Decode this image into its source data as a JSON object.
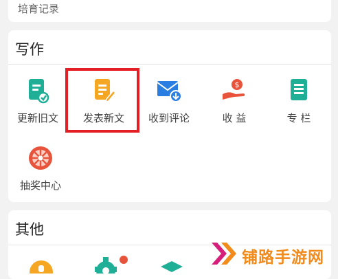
{
  "top_card": {
    "record_label": "培育记录"
  },
  "writing": {
    "title": "写作",
    "items": [
      {
        "label": "更新旧文",
        "icon": "update-doc-icon",
        "color": "#1fae96"
      },
      {
        "label": "发表新文",
        "icon": "new-doc-icon",
        "color": "#f5a623"
      },
      {
        "label": "收到评论",
        "icon": "mail-download-icon",
        "color": "#2a7de1"
      },
      {
        "label": "收 益",
        "icon": "money-hand-icon",
        "color": "#e8533c"
      },
      {
        "label": "专 栏",
        "icon": "column-doc-icon",
        "color": "#1fae96"
      },
      {
        "label": "抽奖中心",
        "icon": "lottery-wheel-icon",
        "color": "#e8533c"
      }
    ],
    "highlight_color": "#e31e24"
  },
  "other": {
    "title": "其他"
  },
  "watermark": {
    "text": "铺路手游网",
    "color": "#f28a1c"
  }
}
